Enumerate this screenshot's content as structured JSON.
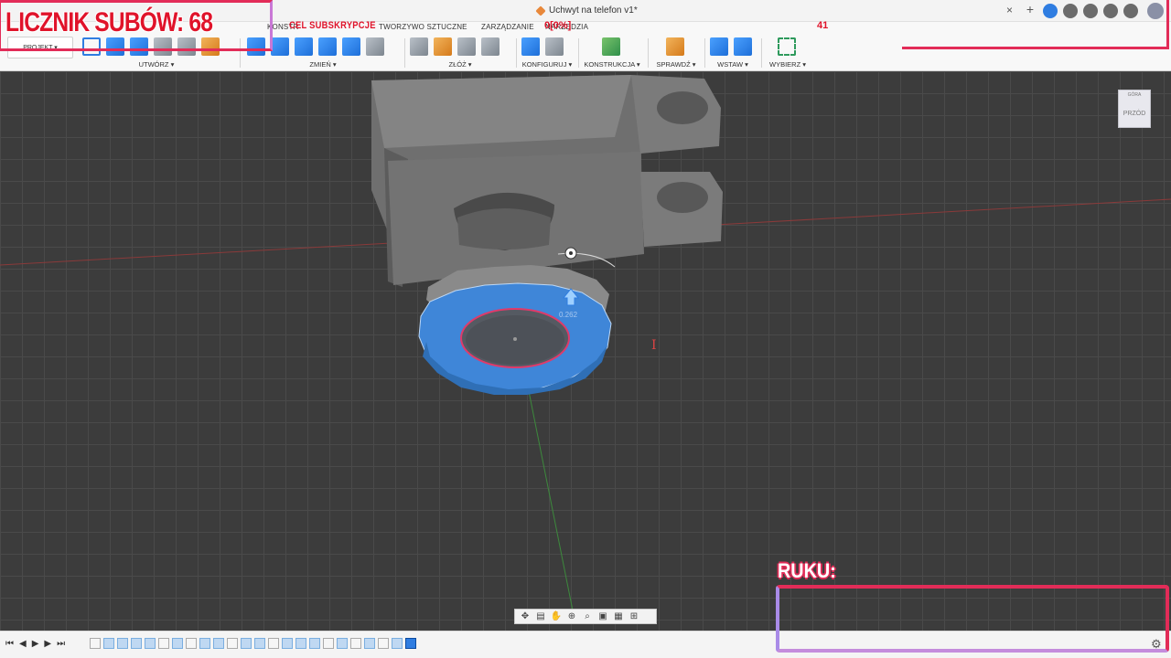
{
  "window": {
    "doc_title": "Uchwyt na telefon v1*",
    "close_glyph": "×",
    "new_tab_glyph": "+"
  },
  "ribbon": {
    "project_button": "PROJEKT ▾",
    "tabs": [
      {
        "label": "KONSTR"
      },
      {
        "label": "TWORZYWO SZTUCZNE"
      },
      {
        "label": "ZARZĄDZANIE"
      },
      {
        "label": "NARZĘDZIA"
      }
    ],
    "groups": [
      {
        "label": "UTWÓRZ ▾"
      },
      {
        "label": "ZMIEŃ ▾"
      },
      {
        "label": "ZŁÓŻ ▾"
      },
      {
        "label": "KONFIGURUJ ▾"
      },
      {
        "label": "KONSTRUKCJA ▾"
      },
      {
        "label": "SPRAWDŹ ▾"
      },
      {
        "label": "WSTAW ▾"
      },
      {
        "label": "WYBIERZ ▾"
      }
    ]
  },
  "viewport": {
    "viewcube_top": "GÓRA",
    "viewcube_front": "PRZÓD",
    "dimension_value": "0.262",
    "cursor_glyph": "I"
  },
  "nav_toolbar": {
    "icons": [
      "orbit-icon",
      "look-at-icon",
      "pan-icon",
      "zoom-icon",
      "fit-icon",
      "display-icon",
      "grid-icon",
      "viewports-icon"
    ]
  },
  "timeline": {
    "controls": [
      "⏮",
      "◀",
      "▶",
      "▶",
      "⏭"
    ],
    "gear_glyph": "⚙"
  },
  "overlay": {
    "sub_counter": "LICZNIK SUBÓW: 68",
    "goal_label": "CEL SUBSKRYPCJE",
    "goal_value": "0[0%]",
    "goal_target": "41",
    "ruku_label": "RUKU:"
  },
  "colors": {
    "accent": "#2f7de1",
    "overlay_red": "#e22c58",
    "overlay_purple": "#a98be8",
    "viewport_bg": "#3c3c3c"
  }
}
